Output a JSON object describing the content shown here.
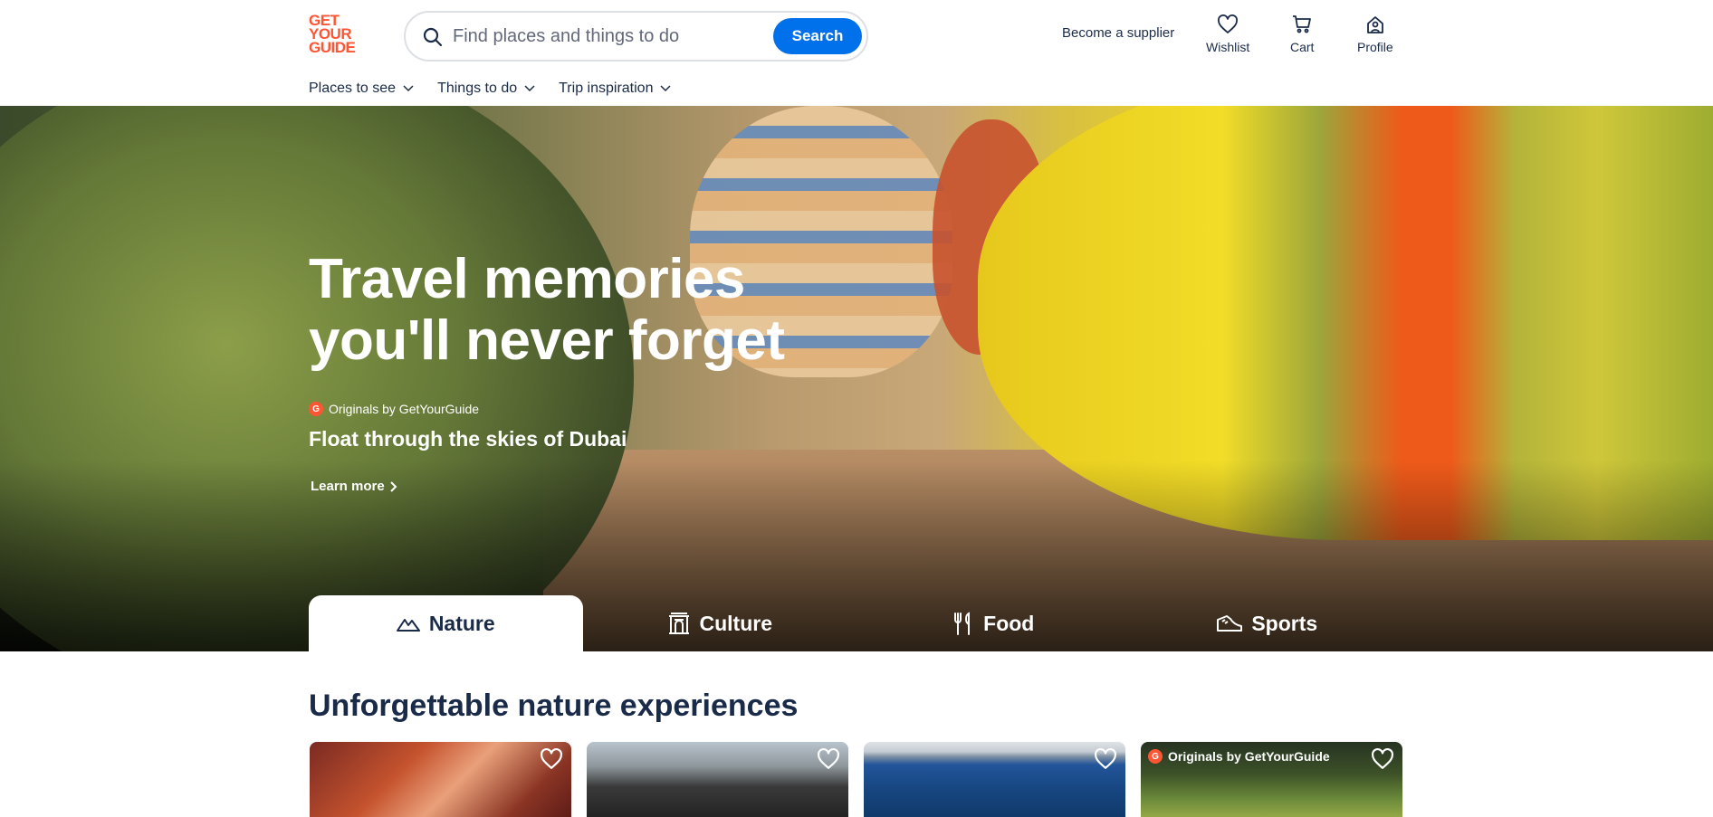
{
  "logo": {
    "lines": [
      "GET",
      "YOUR",
      "GUIDE"
    ]
  },
  "search": {
    "placeholder": "Find places and things to do",
    "button_label": "Search"
  },
  "header": {
    "supplier_label": "Become a supplier",
    "actions": [
      {
        "label": "Wishlist",
        "icon": "heart-icon"
      },
      {
        "label": "Cart",
        "icon": "cart-icon"
      },
      {
        "label": "Profile",
        "icon": "profile-icon"
      }
    ]
  },
  "subnav": [
    {
      "label": "Places to see"
    },
    {
      "label": "Things to do"
    },
    {
      "label": "Trip inspiration"
    }
  ],
  "hero": {
    "title_line1": "Travel memories",
    "title_line2": "you'll never forget",
    "originals_label": "Originals by GetYourGuide",
    "subtitle": "Float through the skies of Dubai",
    "cta_label": "Learn more"
  },
  "tabs": [
    {
      "label": "Nature",
      "icon": "mountain-icon",
      "active": true
    },
    {
      "label": "Culture",
      "icon": "monument-icon",
      "active": false
    },
    {
      "label": "Food",
      "icon": "utensils-icon",
      "active": false
    },
    {
      "label": "Sports",
      "icon": "sneaker-icon",
      "active": false
    }
  ],
  "section": {
    "title": "Unforgettable nature experiences",
    "cards": [
      {
        "badge": ""
      },
      {
        "badge": ""
      },
      {
        "badge": ""
      },
      {
        "badge": "Originals by GetYourGuide"
      }
    ]
  },
  "colors": {
    "brand": "#ff5533",
    "accent": "#0071eb",
    "text": "#1a2b49"
  }
}
